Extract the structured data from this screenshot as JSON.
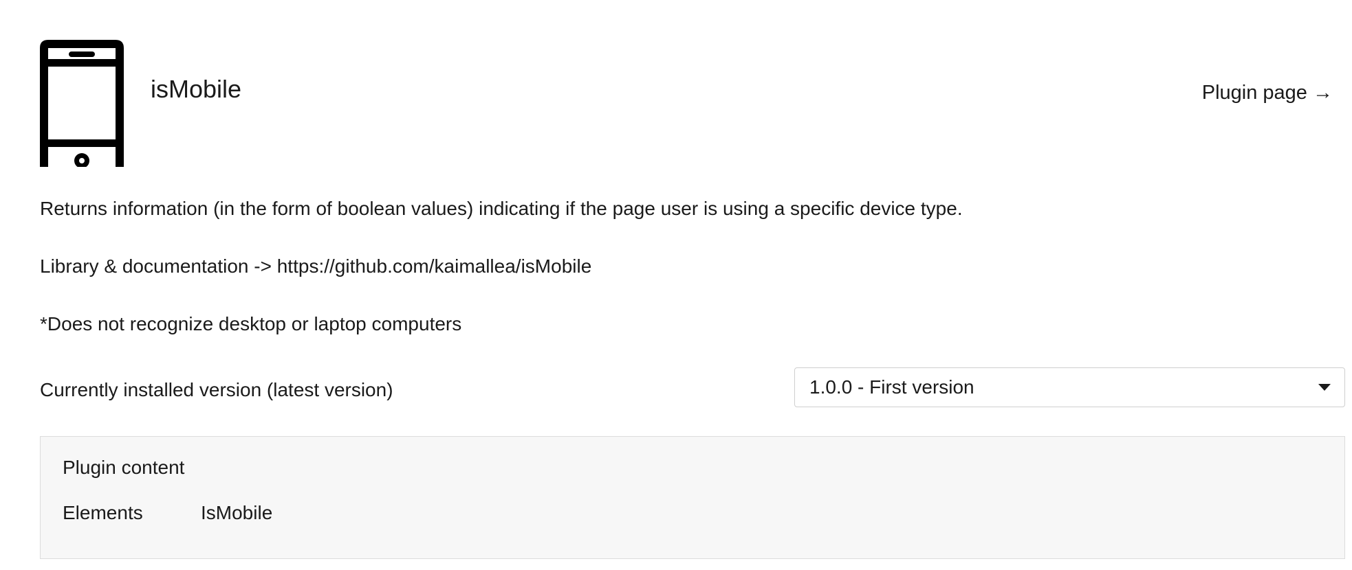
{
  "plugin": {
    "icon": "mobile-phone-icon",
    "name": "isMobile",
    "page_link_label": "Plugin page →"
  },
  "description": {
    "summary": "Returns information (in the form of boolean values) indicating if the page user is using a specific device type.",
    "library_line": "Library & documentation -> https://github.com/kaimallea/isMobile",
    "note": "*Does not recognize desktop or laptop computers"
  },
  "version": {
    "status_label": "Currently installed version (latest version)",
    "selected": "1.0.0 - First version"
  },
  "content": {
    "title": "Plugin content",
    "rows": [
      {
        "label": "Elements",
        "value": "IsMobile"
      }
    ]
  },
  "colors": {
    "text": "#1a1a1a",
    "panel_background": "#f7f7f7",
    "panel_border": "#dcdcdc",
    "select_border": "#cfcfcf"
  }
}
